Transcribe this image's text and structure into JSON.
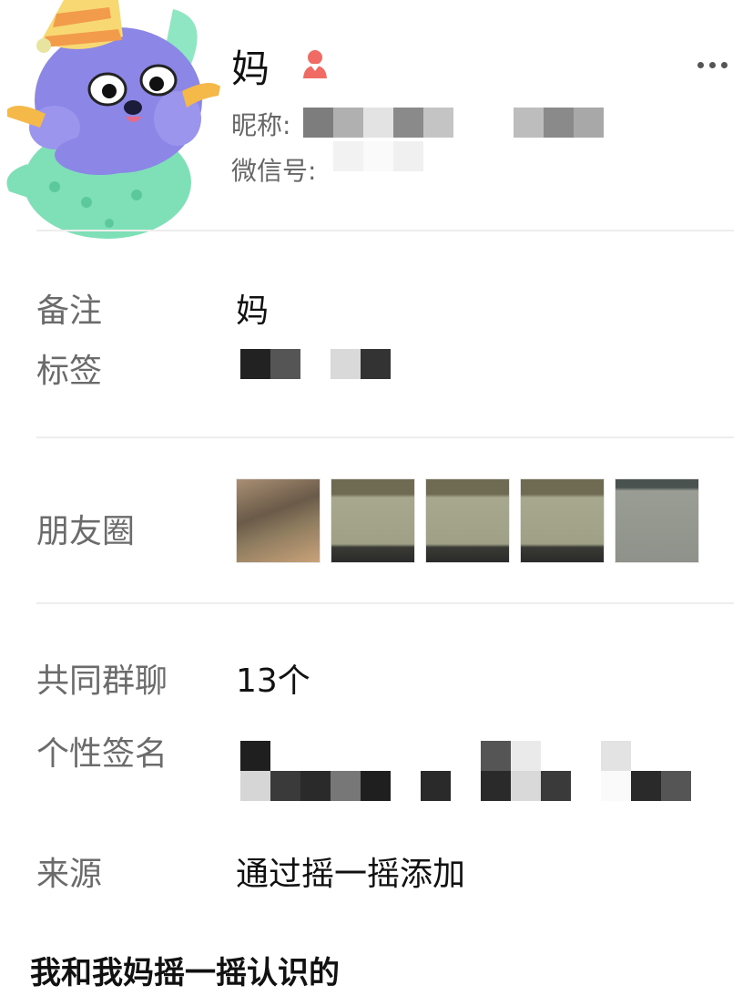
{
  "profile": {
    "name": "妈",
    "gender_icon": "female-icon",
    "nickname_label": "昵称:",
    "wechat_id_label": "微信号:",
    "more_icon": "more-dots-icon",
    "accent_female": "#f06b64"
  },
  "rows": {
    "remark_label": "备注",
    "remark_value": "妈",
    "tags_label": "标签",
    "moments_label": "朋友圈",
    "groups_label": "共同群聊",
    "groups_value": "13个",
    "signature_label": "个性签名",
    "source_label": "来源",
    "source_value": "通过摇一摇添加"
  },
  "caption": "我和我妈摇一摇认识的"
}
